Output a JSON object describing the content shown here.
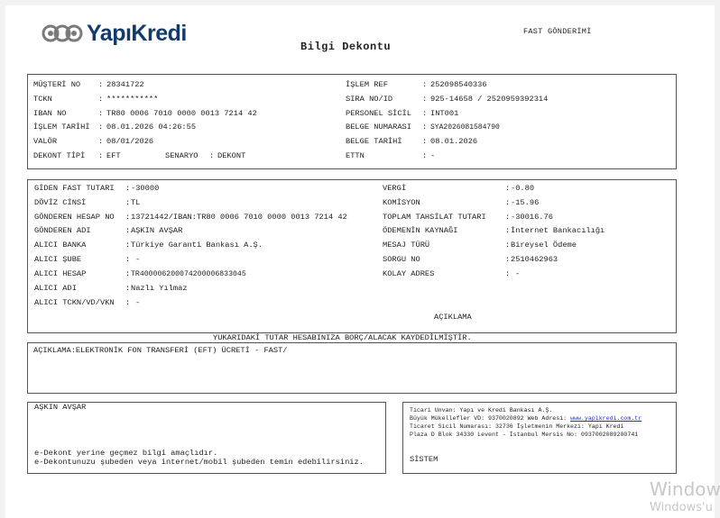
{
  "header": {
    "brand": "YapıKredi",
    "title": "Bilgi Dekontu",
    "transfer_type": "FAST GÖNDERİMİ"
  },
  "info_box": {
    "left": [
      {
        "label": "MÜŞTERİ NO",
        "value": "28341722"
      },
      {
        "label": "TCKN",
        "value": "***********"
      },
      {
        "label": "IBAN NO",
        "value": "TR80 0006 7010 0000 0013 7214 42"
      },
      {
        "label": "İŞLEM TARİHİ",
        "value": "08.01.2026 04:26:55"
      },
      {
        "label": "VALÖR",
        "value": "08/01/2026"
      },
      {
        "label": "DEKONT TİPİ",
        "value": "EFT"
      }
    ],
    "scenario_label": "SENARYO",
    "scenario_value": "DEKONT",
    "right": [
      {
        "label": "İŞLEM REF",
        "value": "252098540336"
      },
      {
        "label": "SIRA NO/ID",
        "value": "925-14658 / 2520959392314"
      },
      {
        "label": "PERSONEL SİCİL",
        "value": "INT001"
      },
      {
        "label": "BELGE NUMARASI",
        "value": "SYA2026081584790"
      },
      {
        "label": "BELGE TARİHİ",
        "value": "08.01.2026"
      },
      {
        "label": "ETTN",
        "value": "-"
      }
    ]
  },
  "transfer_box": {
    "left": [
      {
        "label": "GİDEN FAST TUTARI",
        "value": "-30000"
      },
      {
        "label": "DÖVİZ CİNSİ",
        "value": "TL"
      },
      {
        "label": "GÖNDEREN HESAP NO",
        "value": "13721442/IBAN:TR80 0006 7010 0000 0013 7214 42"
      },
      {
        "label": "GÖNDEREN ADI",
        "value": "AŞKIN AVŞAR"
      },
      {
        "label": "ALICI BANKA",
        "value": "Türkiye Garanti Bankası A.Ş."
      },
      {
        "label": "ALICI ŞUBE",
        "value": "-"
      },
      {
        "label": "ALICI HESAP",
        "value": "TR400006200074200006833045"
      },
      {
        "label": "ALICI ADI",
        "value": "Nazlı Yılmaz"
      },
      {
        "label": "ALICI TCKN/VD/VKN",
        "value": "-"
      }
    ],
    "right": [
      {
        "label": "VERGİ",
        "value": "-0.80"
      },
      {
        "label": "KOMİSYON",
        "value": "-15.96"
      },
      {
        "label": "TOPLAM TAHSİLAT TUTARI",
        "value": "-30016.76"
      },
      {
        "label": "ÖDEMENİN KAYNAĞI",
        "value": "İnternet Bankacılığı"
      },
      {
        "label": "MESAJ TÜRÜ",
        "value": "Bireysel Ödeme"
      },
      {
        "label": "SORGU NO",
        "value": "2510462963"
      },
      {
        "label": "KOLAY ADRES",
        "value": "-"
      }
    ],
    "aciklama_heading": "AÇIKLAMA"
  },
  "debit_notice": "YUKARIDAKİ TUTAR HESABINIZA BORÇ/ALACAK KAYDEDİLMİŞTİR.",
  "description": "AÇIKLAMA:ELEKTRONİK FON TRANSFERİ (EFT) ÜCRETİ - FAST/",
  "customer_box": {
    "name": "AŞKIN AVŞAR",
    "note_line1": "e-Dekont yerine geçmez bilgi amaçlıdır.",
    "note_line2": "e-Dekontunuzu şubeden veya internet/mobil şubeden temin edebilirsiniz."
  },
  "bank_box": {
    "line1": "Ticari Unvan: Yapı ve Kredi Bankası A.Ş.",
    "line2_prefix": "Büyük Mükellefler VD: 9370020892 Web Adresi: ",
    "web_link": "www.yapikredi.com.tr",
    "line3": "Ticaret Sicil Numarası: 32736 İşletmenin Merkezi: Yapı Kredi",
    "line4": "Plaza D Blok 34330 Levent - İstanbul Mersis No: 0937002089200741",
    "system_label": "SİSTEM"
  },
  "watermark": {
    "line1": "Windows",
    "line2": "Windows'u"
  }
}
